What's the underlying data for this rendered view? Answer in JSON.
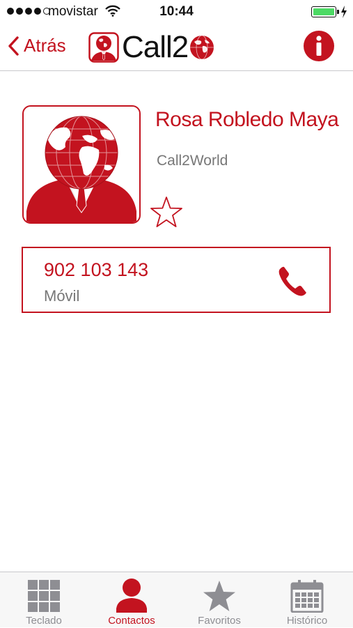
{
  "status_bar": {
    "carrier": "movistar",
    "time": "10:44",
    "signal_bars": 4,
    "battery_level": 1.0
  },
  "nav": {
    "back_label": "Atrás",
    "logo_text": "Call2",
    "info_icon": "info-icon"
  },
  "contact": {
    "name": "Rosa Robledo Maya",
    "company": "Call2World",
    "favorite": false,
    "phones": [
      {
        "number": "902 103 143",
        "type": "Móvil"
      }
    ]
  },
  "colors": {
    "accent": "#c3131f",
    "inactive": "#8e8e93"
  },
  "tabs": [
    {
      "label": "Teclado",
      "icon": "keypad-icon",
      "active": false
    },
    {
      "label": "Contactos",
      "icon": "contact-icon",
      "active": true
    },
    {
      "label": "Favoritos",
      "icon": "star-icon",
      "active": false
    },
    {
      "label": "Histórico",
      "icon": "calendar-icon",
      "active": false
    }
  ]
}
